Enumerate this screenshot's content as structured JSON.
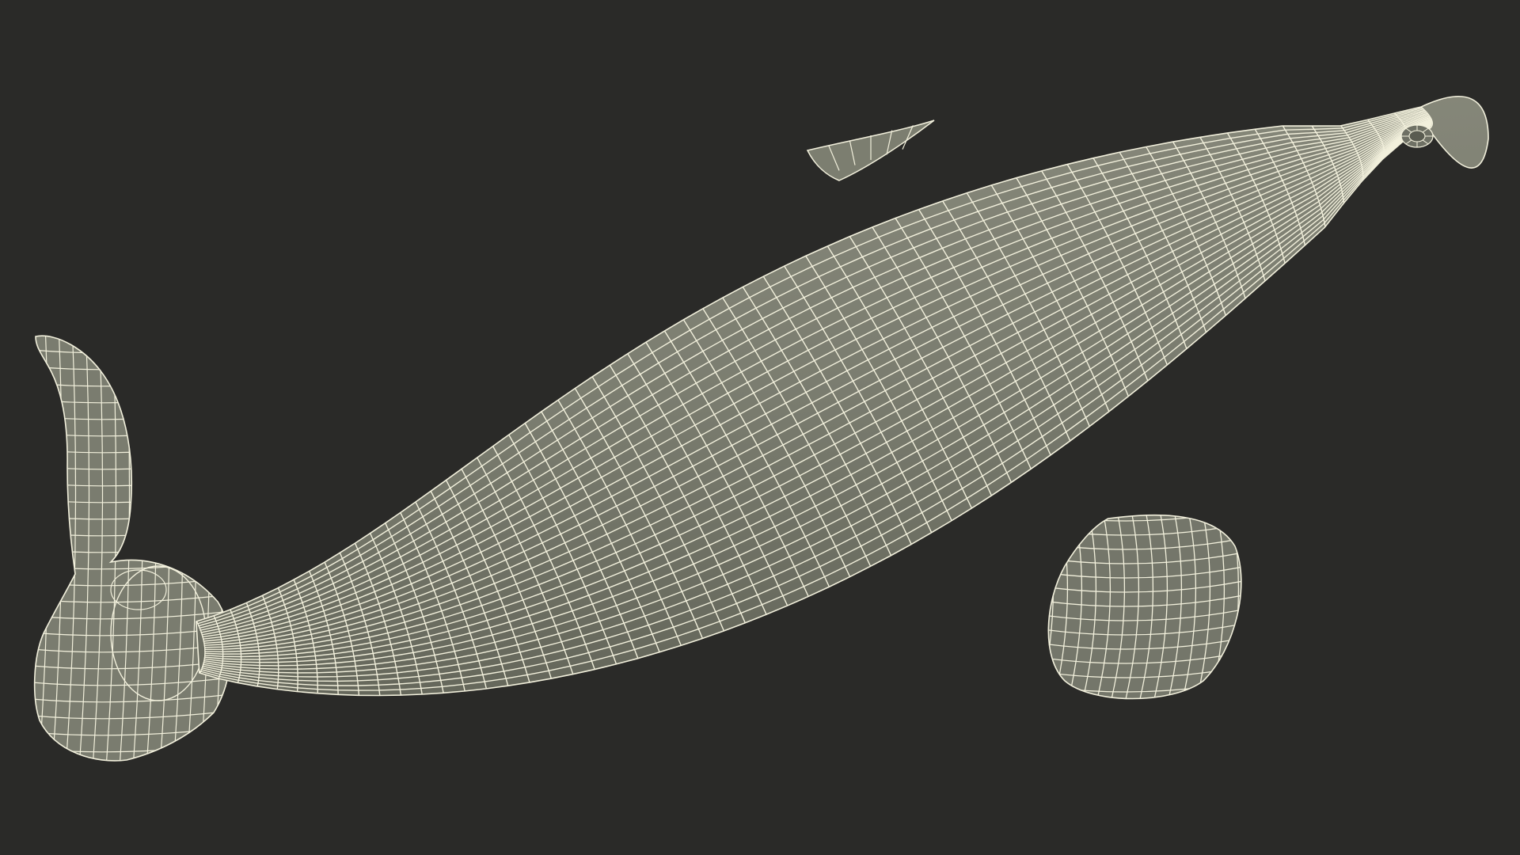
{
  "scene": {
    "subject_icon": "wireframe-whale-icon",
    "background_color": "#2a2a28",
    "mesh_fill_color": "#7c7e70",
    "mesh_shadow_color": "#5d5f53",
    "wire_color": "#f2f0dc"
  }
}
